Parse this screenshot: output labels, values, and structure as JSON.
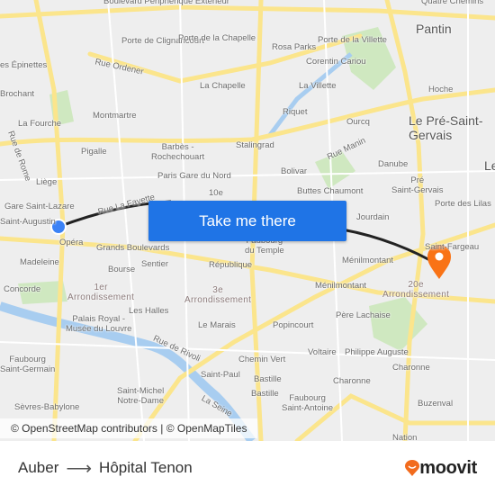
{
  "map": {
    "labels": [
      "Boulevard Périphérique Extérieur",
      "Quatre Chemins",
      "Pantin",
      "Porte de Clignancourt",
      "Porte de la Chapelle",
      "Rosa Parks",
      "Porte de la Villette",
      "Corentin Cariou",
      "es Épinettes",
      "Rue Ordener",
      "La Chapelle",
      "La Villette",
      "Hoche",
      "Brochant",
      "Montmartre",
      "Riquet",
      "Ourcq",
      "Le Pré-Saint-Gervais",
      "La Fourche",
      "Rue de Rome",
      "Pigalle",
      "Barbès - Rochechouart",
      "Stalingrad",
      "Rue Manin",
      "Bolivar",
      "Danube",
      "Paris Gare du Nord",
      "Liège",
      "Pré Saint-Gervais",
      "10e",
      "Buttes Chaumont",
      "Gare Saint-Lazare",
      "Rue La Fayette",
      "Porte des Lilas",
      "Saint-Augustin",
      "Jourdain",
      "Opéra",
      "Faubourg du Temple",
      "Saint-Fargeau",
      "Grands Boulevards",
      "Madeleine",
      "Sentier",
      "République",
      "Ménilmontant",
      "Bourse",
      "Concorde",
      "1er Arrondissement",
      "3e Arrondissement",
      "Ménilmontant",
      "20e Arrondissement",
      "Les Halles",
      "Père Lachaise",
      "Palais Royal - Musée du Louvre",
      "Le Marais",
      "Popincourt",
      "Rue de Rivoli",
      "Voltaire",
      "Philippe Auguste",
      "Chemin Vert",
      "Faubourg Saint-Germain",
      "Charonne",
      "Saint-Paul",
      "Charonne",
      "Bastille",
      "Saint-Michel Notre-Dame",
      "Bastille",
      "Faubourg Saint-Antoine",
      "Sèvres-Babylone",
      "La Seine",
      "Buzenval",
      "Nation",
      "Le"
    ],
    "origin_marker_color": "#3b82f6",
    "destination_marker_color": "#f97316",
    "route_color": "#222222"
  },
  "cta": {
    "label": "Take me there"
  },
  "attribution": "© OpenStreetMap contributors | © OpenMapTiles",
  "footer": {
    "origin": "Auber",
    "arrow_icon": "arrow-right-icon",
    "destination": "Hôpital Tenon",
    "logo_text": "moovit",
    "brand_color": "#f26b1d"
  }
}
